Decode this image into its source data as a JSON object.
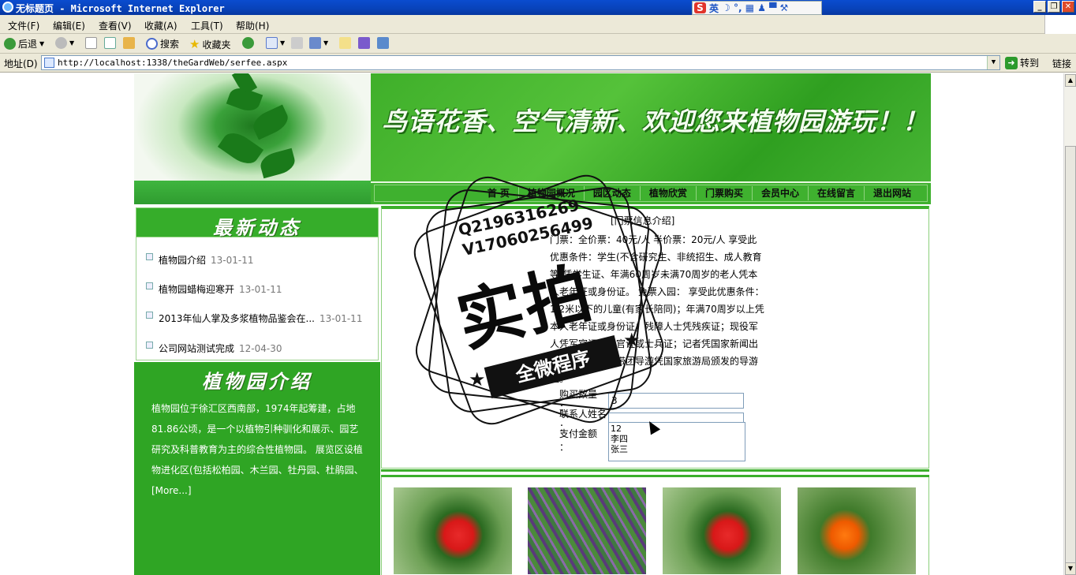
{
  "window": {
    "title": "无标题页 - Microsoft Internet Explorer",
    "ime": {
      "s_label": "S",
      "lang": "英",
      "icons": "☽ °, ▦ ♟ ▀ ⚒"
    }
  },
  "menu": [
    "文件(F)",
    "编辑(E)",
    "查看(V)",
    "收藏(A)",
    "工具(T)",
    "帮助(H)"
  ],
  "toolbar": {
    "back": "后退",
    "search": "搜索",
    "favorites": "收藏夹"
  },
  "address": {
    "label": "地址(D)",
    "url": "http://localhost:1338/theGardWeb/serfee.aspx",
    "go": "转到",
    "links": "链接"
  },
  "site": {
    "slogan": "鸟语花香、空气清新、欢迎您来植物园游玩！！",
    "nav": [
      "首 页",
      "植物园概况",
      "园区动态",
      "植物欣赏",
      "门票购买",
      "会员中心",
      "在线留言",
      "退出网站"
    ],
    "news": {
      "title": "最新动态",
      "items": [
        {
          "text": "植物园介绍",
          "date": "13-01-11"
        },
        {
          "text": "植物园蜡梅迎寒开",
          "date": "13-01-11"
        },
        {
          "text": "2013年仙人掌及多浆植物品鉴会在...",
          "date": "13-01-11"
        },
        {
          "text": "公司网站测试完成",
          "date": "12-04-30"
        }
      ]
    },
    "intro": {
      "title": "植物园介绍",
      "text": "植物园位于徐汇区西南部，1974年起筹建，占地81.86公顷，是一个以植物引种驯化和展示、园艺研究及科普教育为主的综合性植物园。 展览区设植物进化区(包括松柏园、木兰园、牡丹园、杜鹃园、[More...]"
    },
    "ticket": {
      "title": "[门票信息介绍]",
      "body": "门票：全价票：40元/人 半价票：20元/人 享受此优惠条件：学生(不含研究生、非统招生、成人教育等)凭学生证、年满60周岁未满70周岁的老人凭本人老年证或身份证。 免票入园： 享受此优惠条件：1.2米以下的儿童(有家长陪同)；年满70周岁以上凭本人老年证或身份证；残障人士凭残疾证；现役军人凭军官证、士官证或士兵证；记者凭国家新闻出版署的记者证；带团导游凭国家旅游局颁发的导游证。",
      "qty_label": "购买数量 ：",
      "qty_value": "3",
      "name_label": "联系人姓名 ：",
      "name_value": "",
      "pay_label": "支付金额 ：",
      "pay_value": "12\n李四\n张三"
    }
  },
  "watermark": {
    "qq": "Q2196316269",
    "v": "V17060256499",
    "big": "实拍",
    "ribbon": "全微程序"
  }
}
